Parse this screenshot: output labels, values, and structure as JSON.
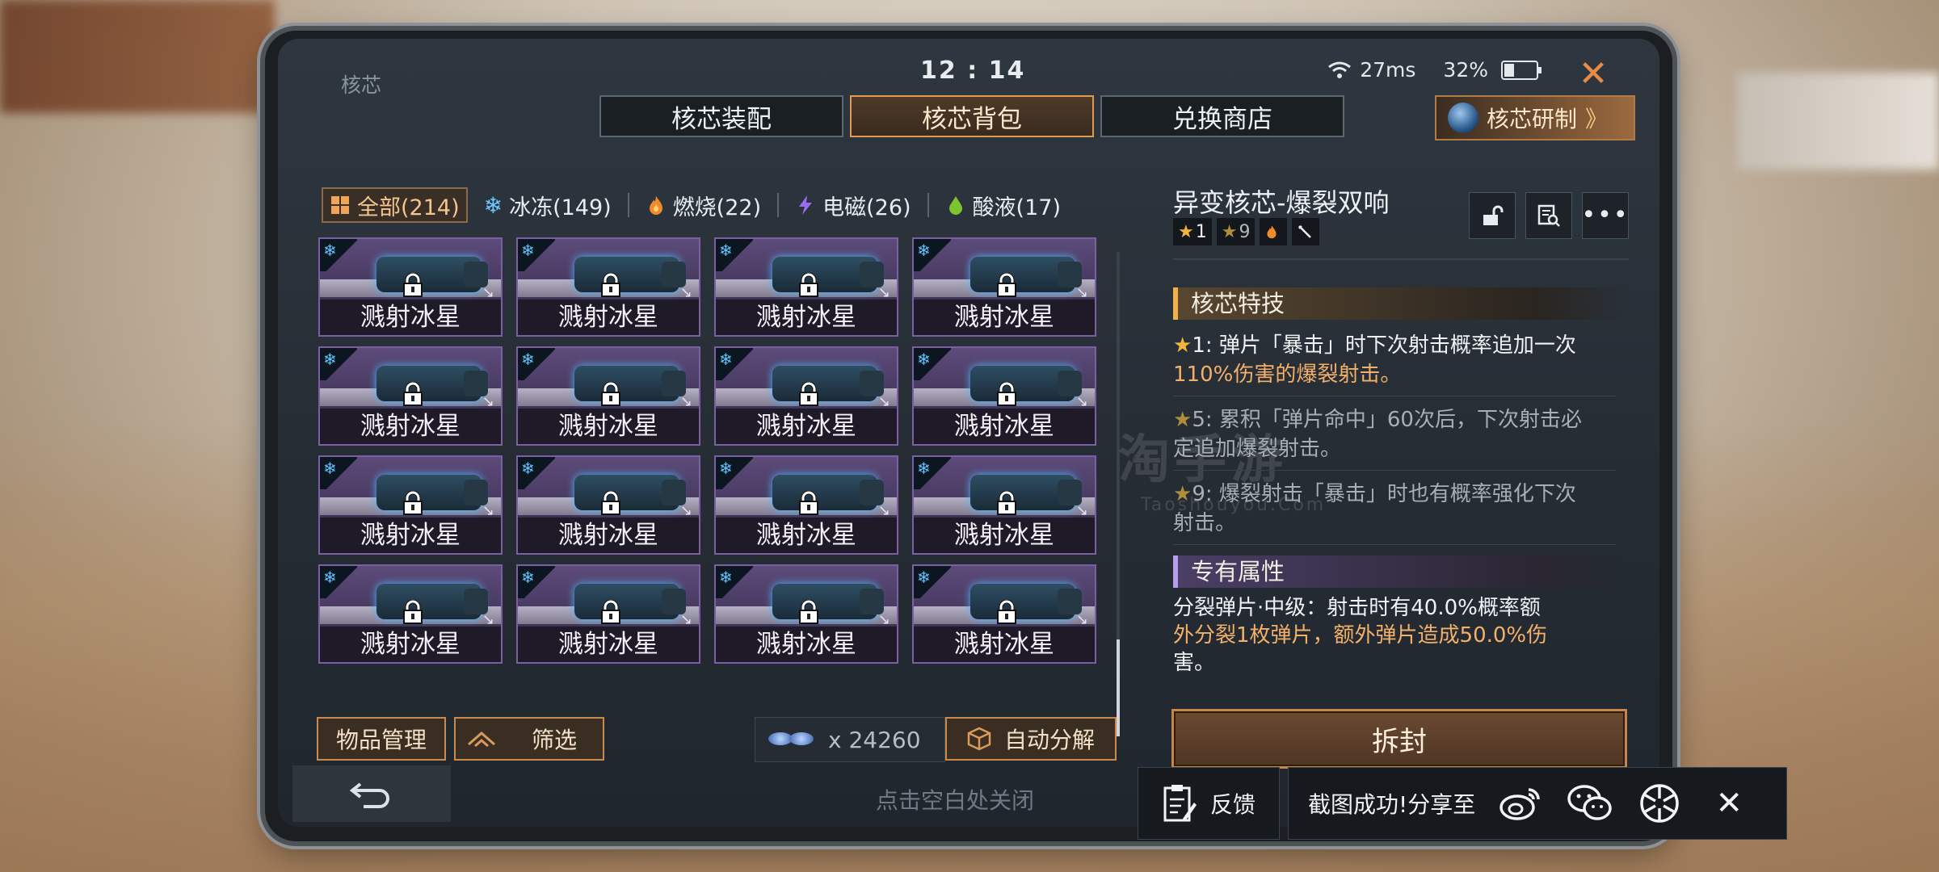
{
  "top": {
    "title": "核芯",
    "clock": "12 : 14",
    "ping": "27ms",
    "battery": "32%",
    "battery_level": 0.32
  },
  "tabs": [
    {
      "label": "核芯装配",
      "active": false
    },
    {
      "label": "核芯背包",
      "active": true
    },
    {
      "label": "兑换商店",
      "active": false
    }
  ],
  "research_label": "核芯研制",
  "filters": [
    {
      "label": "全部(214)",
      "icon": "grid-icon",
      "active": true
    },
    {
      "label": "冰冻(149)",
      "icon": "snowflake-icon"
    },
    {
      "label": "燃烧(22)",
      "icon": "flame-icon"
    },
    {
      "label": "电磁(26)",
      "icon": "lightning-icon"
    },
    {
      "label": "酸液(17)",
      "icon": "acid-drop-icon"
    }
  ],
  "items": [
    "溅射冰星",
    "溅射冰星",
    "溅射冰星",
    "溅射冰星",
    "溅射冰星",
    "溅射冰星",
    "溅射冰星",
    "溅射冰星",
    "溅射冰星",
    "溅射冰星",
    "溅射冰星",
    "溅射冰星",
    "溅射冰星",
    "溅射冰星",
    "溅射冰星",
    "溅射冰星"
  ],
  "bottom_left": {
    "manage_label": "物品管理",
    "filter_label": "筛选",
    "crystal_count": "x 24260",
    "auto_decompose_label": "自动分解"
  },
  "detail": {
    "title": "异变核芯-爆裂双响",
    "tag_star1": "1",
    "tag_star9": "9",
    "section_skill": "核芯特技",
    "skills": [
      {
        "prefix": "1: 弹片「暴击」时下次射击概率追加一次",
        "tail": "110%伤害的爆裂射击。",
        "active": true
      },
      {
        "prefix": "5: 累积「弹片命中」60次后，下次射击必",
        "tail": "定追加爆裂射击。",
        "active": false
      },
      {
        "prefix": "9: 爆裂射击「暴击」时也有概率强化下次",
        "tail": "射击。",
        "active": false
      }
    ],
    "section_attr": "专有属性",
    "attr_line1": "分裂弹片·中级：射击时有40.0%概率额",
    "attr_line2": "外分裂1枚弹片，额外弹片造成50.0%伤",
    "attr_line3": "害。",
    "unseal_label": "拆封"
  },
  "footer": {
    "hint": "点击空白处关闭"
  },
  "share": {
    "feedback_label": "反馈",
    "share_text": "截图成功!分享至"
  },
  "watermark": {
    "main": "淘手游",
    "sub": "Taoshouyou.Com"
  }
}
